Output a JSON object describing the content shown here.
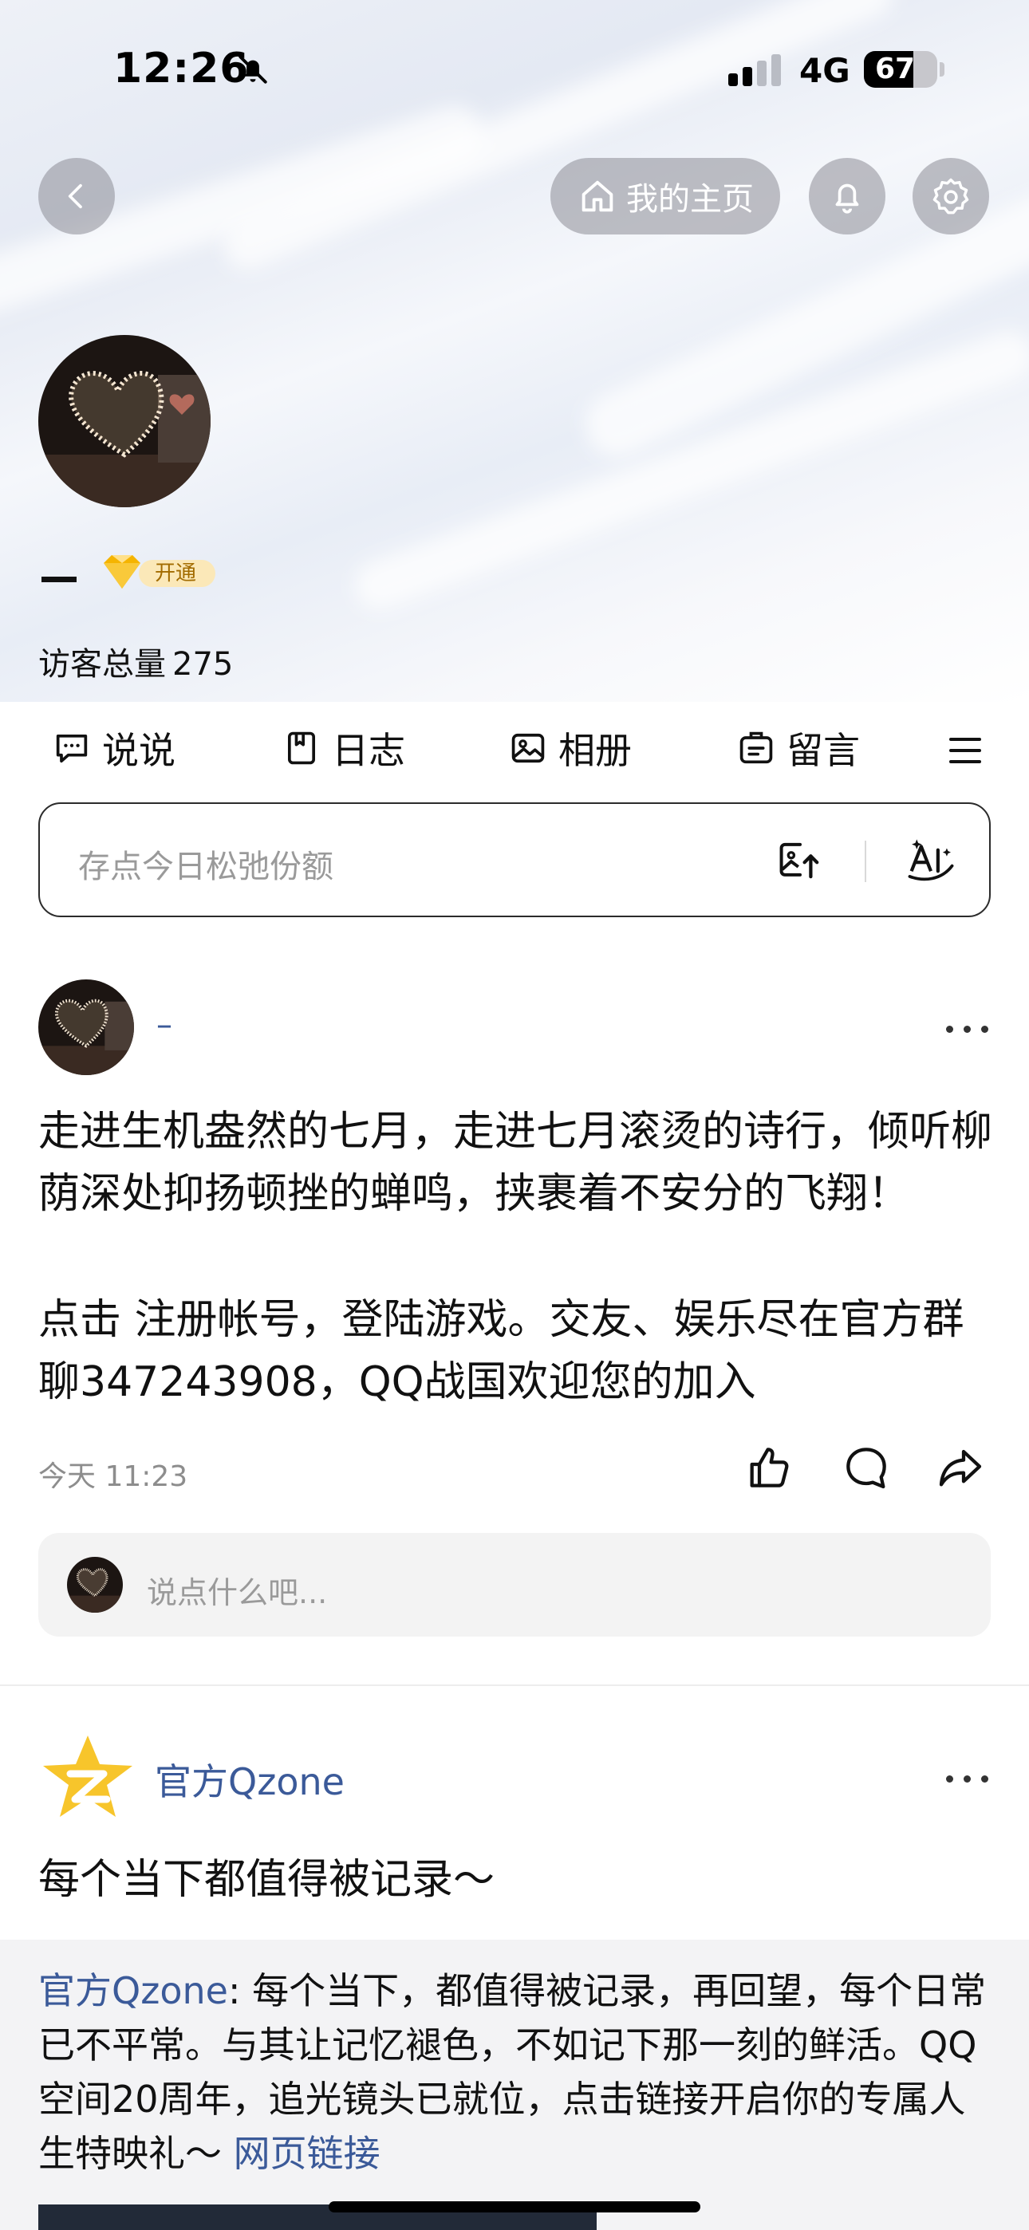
{
  "status_bar": {
    "time": "12:26",
    "network": "4G",
    "battery": "67",
    "battery_level": 0.67,
    "icons": [
      "bell-slash-icon",
      "signal-icon"
    ]
  },
  "header": {
    "home_label": "我的主页",
    "icons": [
      "chevron-left-icon",
      "home-icon",
      "bell-icon",
      "gear-icon"
    ]
  },
  "profile": {
    "name": "–",
    "vip_label": "开通",
    "visitors_label": "访客总量",
    "visitors_count": "275"
  },
  "tabs": [
    {
      "label": "说说",
      "icon": "chat-bubble-icon"
    },
    {
      "label": "日志",
      "icon": "bookmark-note-icon"
    },
    {
      "label": "相册",
      "icon": "image-icon"
    },
    {
      "label": "留言",
      "icon": "message-board-icon"
    }
  ],
  "composer": {
    "placeholder": "存点今日松弛份额",
    "icons": [
      "image-upload-icon",
      "ai-magic-icon"
    ]
  },
  "post1": {
    "author": "–",
    "paragraph1": "走进生机盎然的七月，走进七月滚烫的诗行，倾听柳荫深处抑扬顿挫的蝉鸣，挟裹着不安分的飞翔！",
    "paragraph2": "点击 注册帐号，登陆游戏。交友、娱乐尽在官方群聊347243908，QQ战国欢迎您的加入",
    "time": "今天 11:23",
    "comment_placeholder": "说点什么吧...",
    "icons": [
      "thumbs-up-icon",
      "comment-icon",
      "share-icon",
      "more-icon"
    ]
  },
  "post2": {
    "author": "官方Qzone",
    "title": "每个当下都值得被记录～",
    "quote_author": "官方Qzone",
    "quote_text": ": 每个当下，都值得被记录，再回望，每个日常已不平常。与其让记忆褪色，不如记下那一刻的鲜活。QQ空间20周年，追光镜头已就位，点击链接开启你的专属人生特映礼～ ",
    "quote_link": "网页链接"
  },
  "colors": {
    "link_blue": "#3b5a99",
    "vip_gold": "#f5b400",
    "qzone_star": "#f7c52b"
  }
}
